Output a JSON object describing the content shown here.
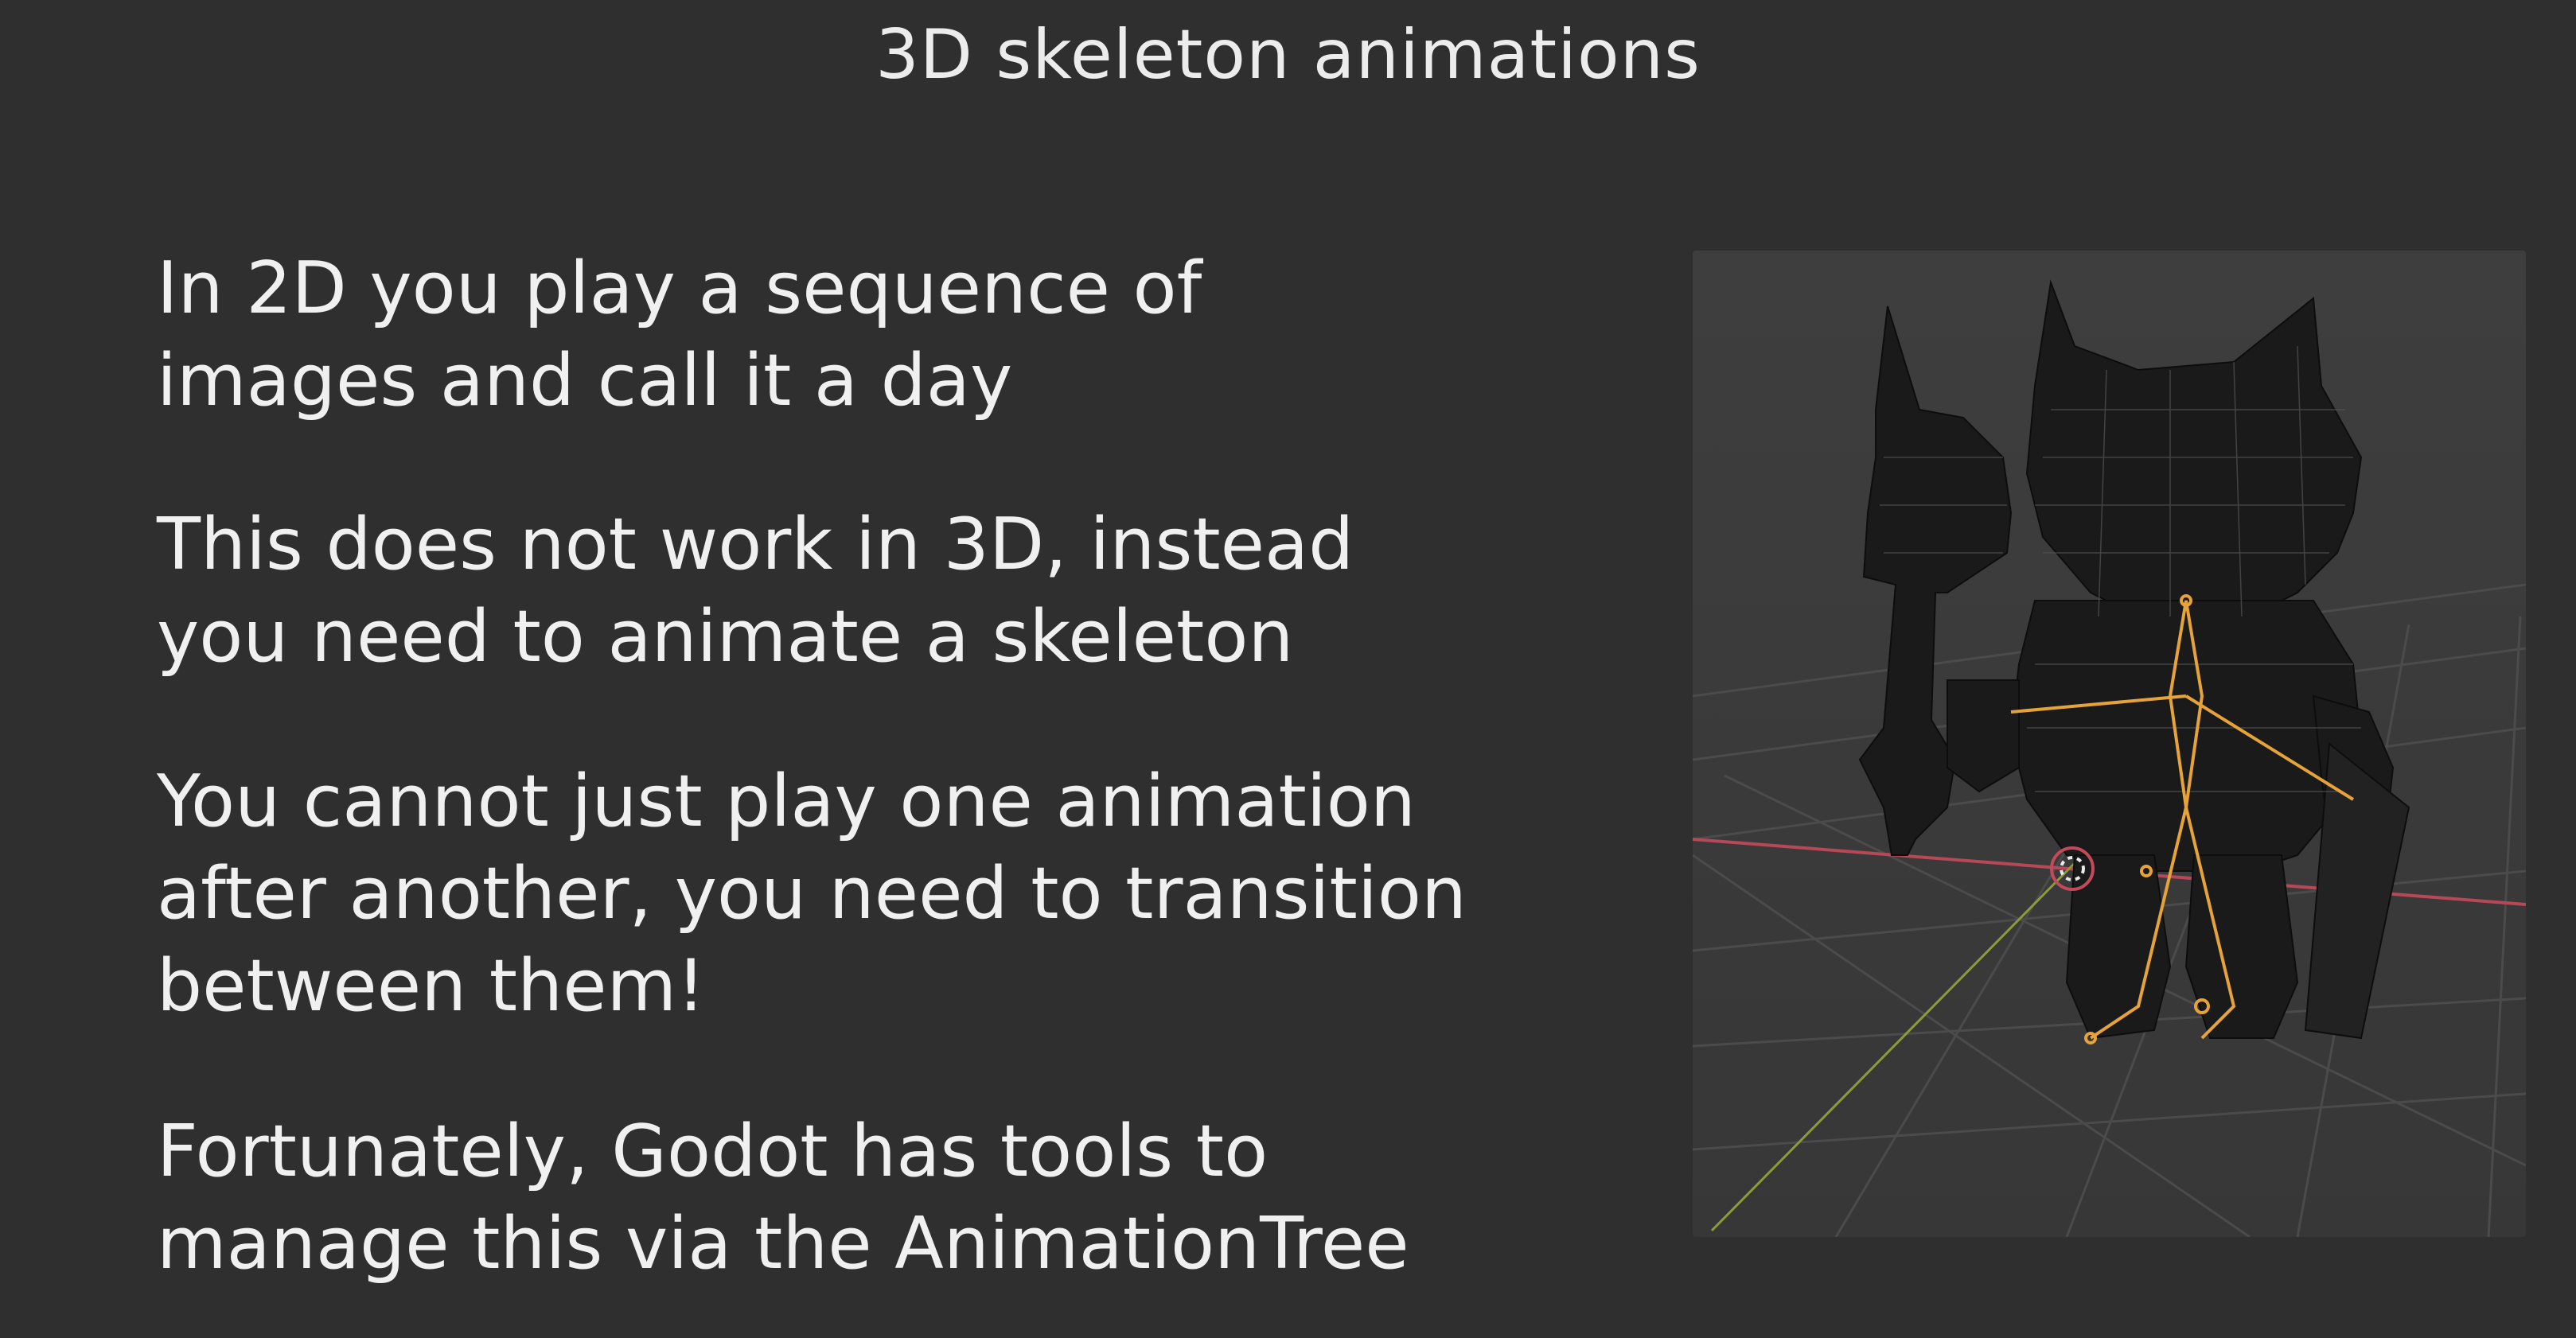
{
  "slide": {
    "title": "3D skeleton animations",
    "paragraphs": [
      "In 2D you play a sequence of\nimages and call it a day",
      "This does not work in 3D, instead\nyou need to animate a skeleton",
      "You cannot just play one animation\nafter another, you need to transition\nbetween them!",
      "Fortunately, Godot has tools to\nmanage this via the AnimationTree"
    ]
  },
  "viewport": {
    "background_color": "#3c3c3c",
    "grid_color": "#4a4a4a",
    "x_axis_color": "#c24a5a",
    "y_axis_color": "#8a9a3a",
    "mesh_color": "#151515",
    "bone_color": "#e8a53a"
  }
}
